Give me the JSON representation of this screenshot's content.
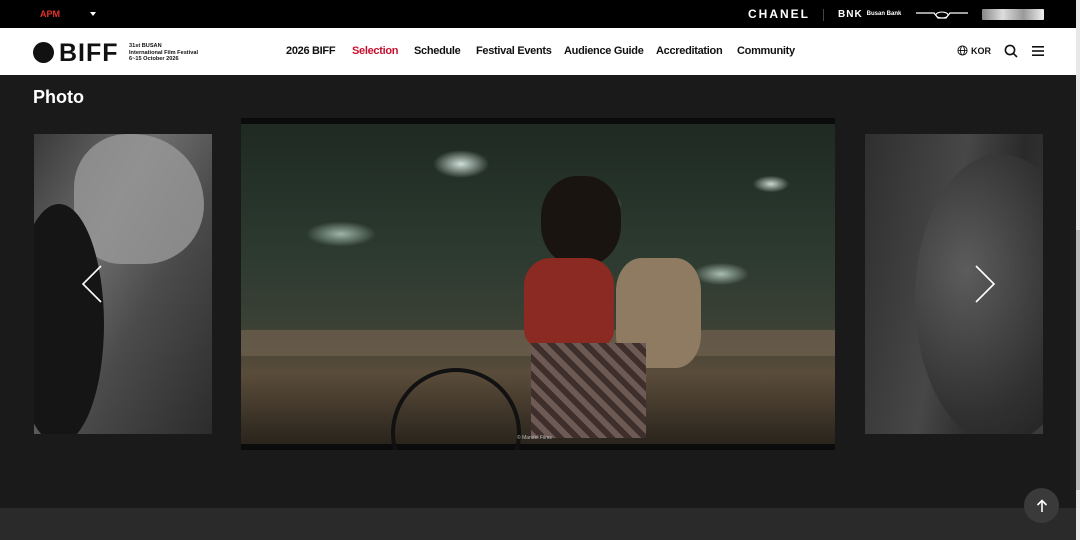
{
  "topbar": {
    "region_select": "APM",
    "sponsors": {
      "chanel": "CHANEL",
      "bnk": "BNK",
      "bnk_sub": "Busan Bank"
    }
  },
  "nav": {
    "logo": {
      "word": "BIFF",
      "line1": "31st BUSAN",
      "line2": "International Film Festival",
      "line3": "6~15 October 2026"
    },
    "menu": [
      {
        "label": "2026 BIFF",
        "active": false
      },
      {
        "label": "Selection",
        "active": true
      },
      {
        "label": "Schedule",
        "active": false
      },
      {
        "label": "Festival Events",
        "active": false
      },
      {
        "label": "Audience Guide",
        "active": false
      },
      {
        "label": "Accreditation",
        "active": false
      },
      {
        "label": "Community",
        "active": false
      }
    ],
    "language": "KOR",
    "icons": [
      "globe-icon",
      "search-icon",
      "hamburger-icon"
    ]
  },
  "gallery": {
    "title": "Photo",
    "main_credit": "© Mandel Films",
    "controls": [
      "chevron-left-icon",
      "chevron-right-icon"
    ]
  },
  "colors": {
    "accent": "#c8102e",
    "background": "#1a1a1a",
    "nav_bg": "#ffffff",
    "topbar_bg": "#000000"
  },
  "to_top": {
    "icon": "arrow-up-icon"
  }
}
